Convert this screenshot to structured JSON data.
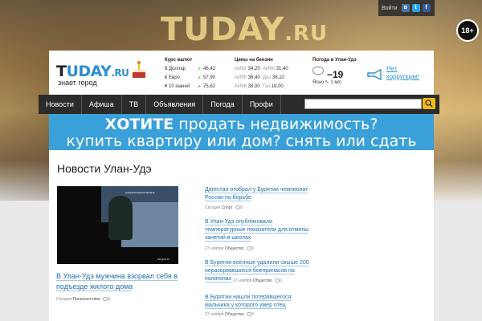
{
  "hero": {
    "logo": "TUDAY",
    "logo_ru": ".RU"
  },
  "topbar": {
    "login": "Войти",
    "social": [
      "vk-icon",
      "twitter-icon",
      "facebook-icon"
    ]
  },
  "age": "18+",
  "header": {
    "logo_t": "T",
    "logo_rest": "UDAY",
    "logo_ru": ".RU",
    "slogan": "знает город",
    "rates": {
      "title": "Курс валют",
      "items": [
        {
          "label": "$ Доллар",
          "value": "46,42"
        },
        {
          "label": "€ Евро",
          "value": "57,90"
        },
        {
          "label": "¥ 10 юаней",
          "value": "75,62"
        }
      ]
    },
    "fuel": {
      "title": "Цены на бензин",
      "items": [
        {
          "name": "АИ92",
          "price": "34,20",
          "name2": "АИ80",
          "price2": "31,40"
        },
        {
          "name": "АИ95",
          "price": "36,40",
          "name2": "Диз",
          "price2": "36,10"
        },
        {
          "name": "АИ98",
          "price": "38,00",
          "name2": "Газ",
          "price2": "18,00"
        }
      ]
    },
    "weather": {
      "title": "Погода в Улан-Удэ",
      "temp": "−19",
      "state": "Ясно,↖ 1 м/с"
    },
    "corruption": "Нет коррупции!"
  },
  "nav": [
    "Новости",
    "Афиша",
    "ТВ",
    "Объявления",
    "Погода",
    "Профи"
  ],
  "search": {
    "placeholder": ""
  },
  "banner": {
    "l1_bold": "ХОТИТЕ",
    "l1": " продать недвижимость?",
    "l2": "купить квартиру или дом? снять или сдать жилье?"
  },
  "page_title": "Новости Улан-Удэ",
  "video": {
    "tv_label": "НАЦИОНАЛЬНАЯ ВОЛНА",
    "watermark": "arigus.tv"
  },
  "main_news": {
    "title": "В Улан-Удэ мужчина взорвал себя в подъезде жилого дома",
    "date": "Сегодня",
    "category": "Происшествия",
    "comments": "0"
  },
  "news": [
    {
      "title": "Дагестан отобрал у Бурятии чемпионат России по борьбе",
      "date": "Сегодня",
      "category": "Спорт",
      "comments": "0"
    },
    {
      "title": "В Улан-Удэ опубликовали температурные показатели для отмены занятий в школах",
      "date": "27 ноября",
      "category": "Общество",
      "comments": "0"
    },
    {
      "title": "В Бурятии военные удалили свыше 200 неразорвавшихся боеприпасов на полигонах",
      "date": "27 ноября",
      "category": "Общество",
      "comments": "0"
    },
    {
      "title": "В Бурятии нашли потерявшегося мальчика у которого умер отец",
      "date": "27 ноября",
      "category": "Общество",
      "comments": "0"
    }
  ]
}
